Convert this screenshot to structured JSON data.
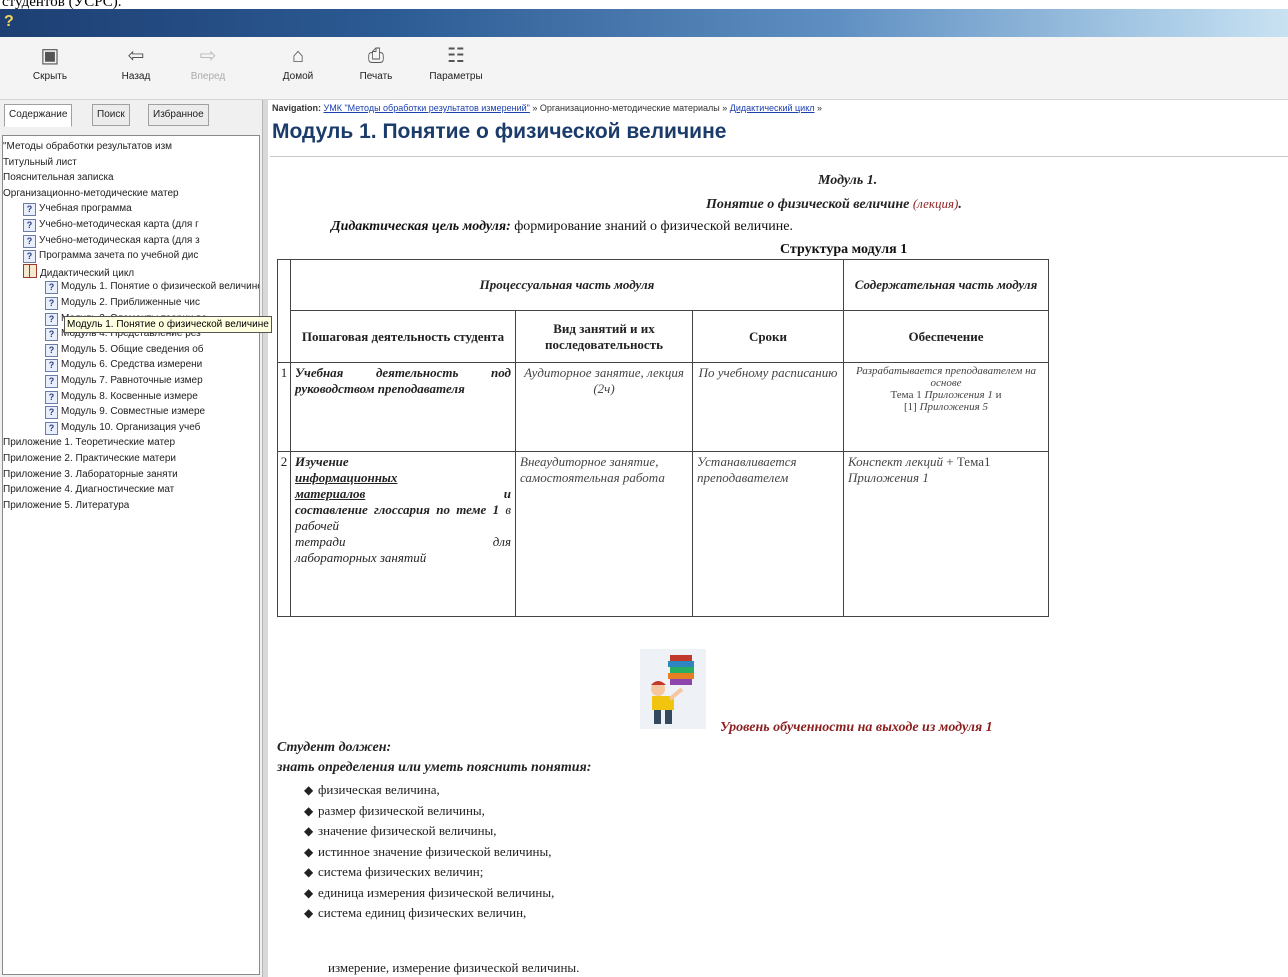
{
  "page_top_text": "студентов (УСРС).",
  "toolbar": {
    "buttons": [
      {
        "label": "Скрыть",
        "icon": "hide-pane-icon",
        "glyph": "▣",
        "enabled": true
      },
      {
        "label": "Назад",
        "icon": "back-arrow-icon",
        "glyph": "⇦",
        "enabled": true
      },
      {
        "label": "Вперед",
        "icon": "forward-arrow-icon",
        "glyph": "⇨",
        "enabled": false
      },
      {
        "label": "Домой",
        "icon": "home-icon",
        "glyph": "⌂",
        "enabled": true
      },
      {
        "label": "Печать",
        "icon": "printer-icon",
        "glyph": "⎙",
        "enabled": true
      },
      {
        "label": "Параметры",
        "icon": "options-icon",
        "glyph": "☷",
        "enabled": true
      }
    ]
  },
  "left_tabs": [
    "Содержание",
    "Поиск",
    "Избранное"
  ],
  "tree": [
    {
      "text": "\"Методы обработки результатов изм",
      "indent": 0,
      "icon": "none"
    },
    {
      "text": "Титульный лист",
      "indent": 0,
      "icon": "none"
    },
    {
      "text": "Пояснительная записка",
      "indent": 0,
      "icon": "none"
    },
    {
      "text": "Организационно-методические матер",
      "indent": 0,
      "icon": "none"
    },
    {
      "text": "Учебная программа",
      "indent": 1,
      "icon": "help"
    },
    {
      "text": "Учебно-методическая карта (для г",
      "indent": 1,
      "icon": "help"
    },
    {
      "text": "Учебно-методическая карта (для з",
      "indent": 1,
      "icon": "help"
    },
    {
      "text": "Программа зачета по учебной дис",
      "indent": 1,
      "icon": "help"
    },
    {
      "text": "Дидактический цикл",
      "indent": 1,
      "icon": "book"
    },
    {
      "text": "Модуль 1. Понятие о физической величине",
      "indent": 2,
      "icon": "help",
      "selected": true
    },
    {
      "text": "Модуль 2. Приближенные чис",
      "indent": 2,
      "icon": "help"
    },
    {
      "text": "Модуль 3. Элементы теории ве",
      "indent": 2,
      "icon": "help"
    },
    {
      "text": "Модуль 4. Представление рез",
      "indent": 2,
      "icon": "help"
    },
    {
      "text": "Модуль 5. Общие сведения об",
      "indent": 2,
      "icon": "help"
    },
    {
      "text": "Модуль 6. Средства измерени",
      "indent": 2,
      "icon": "help"
    },
    {
      "text": "Модуль 7. Равноточные измер",
      "indent": 2,
      "icon": "help"
    },
    {
      "text": "Модуль 8. Косвенные измере",
      "indent": 2,
      "icon": "help"
    },
    {
      "text": "Модуль 9. Совместные измере",
      "indent": 2,
      "icon": "help"
    },
    {
      "text": "Модуль 10. Организация учеб",
      "indent": 2,
      "icon": "help"
    },
    {
      "text": "Приложение 1. Теоретические матер",
      "indent": 0,
      "icon": "none"
    },
    {
      "text": "Приложение 2. Практические матери",
      "indent": 0,
      "icon": "none"
    },
    {
      "text": "Приложение 3. Лабораторные заняти",
      "indent": 0,
      "icon": "none"
    },
    {
      "text": "Приложение 4. Диагностические мат",
      "indent": 0,
      "icon": "none"
    },
    {
      "text": "Приложение 5. Литература",
      "indent": 0,
      "icon": "none"
    }
  ],
  "tooltip": "Модуль 1. Понятие о физической величине",
  "nav": {
    "prefix": "Navigation:",
    "link1": "УМК \"Методы обработки результатов измерений\"",
    "sep": "»",
    "item2": "Организационно-методические материалы",
    "link3": "Дидактический цикл"
  },
  "page_title": "Модуль 1. Понятие о физической величине",
  "module": {
    "head1": "Модуль 1.",
    "head2_bold": "Понятие о физической величине",
    "head2_paren": "(лекция)",
    "head2_end": ".",
    "goal_label": "Дидактическая цель модуля:",
    "goal_text": " формирование знаний о физической величине.",
    "structure_label": "Структура модуля 1"
  },
  "table": {
    "group1": "Процессуальная часть модуля",
    "group2": "Содержательная часть модуля",
    "headers": [
      "Пошаговая деятельность студента",
      "Вид занятий и их последовательность",
      "Сроки",
      "Обеспечение"
    ],
    "rows": [
      {
        "num": "1",
        "col1": "Учебная деятельность под руководством преподавателя",
        "col2": "Аудиторное занятие, лекция (2ч)",
        "col3": "По учебному расписанию",
        "col4_a": "Разрабатывается преподавателем на основе",
        "col4_b": "Тема 1",
        "col4_c": "Приложения 1",
        "col4_d": "и",
        "col4_e": "[1]",
        "col4_f": "Приложения 5"
      },
      {
        "num": "2",
        "col1_a": "Изучение",
        "col1_b": "информационных",
        "col1_c": "материалов",
        "col1_d": "и",
        "col1_e": "составление глоссария по теме 1",
        "col1_f": "в рабочей",
        "col1_g": "тетради",
        "col1_h": "для",
        "col1_i": "лабораторных занятий",
        "col2": "Внеаудиторное занятие, самостоятельная работа",
        "col3": "Устанавливается преподавателем",
        "col4_a": "Конспект лекций",
        "col4_b": "+ Тема1",
        "col4_c": "Приложения 1"
      }
    ]
  },
  "level_heading": "Уровень обученности на выходе из модуля 1",
  "student_must": "Студент должен:",
  "know_terms": "знать определения или уметь пояснить понятия:",
  "terms": [
    "физическая величина,",
    "размер физической величины,",
    "значение физической величины,",
    "истинное значение физической величины,",
    "система физических величин;",
    "единица измерения физической величины,",
    "система единиц физических величин,"
  ],
  "terms_continuation": "измерение, измерение физической величины."
}
